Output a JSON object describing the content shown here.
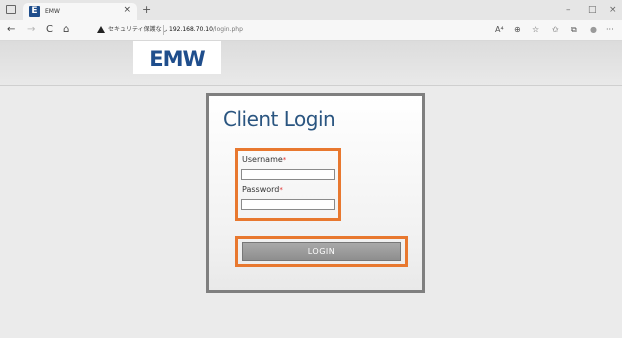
{
  "browser": {
    "tab": {
      "favicon": "E",
      "title": "EMW",
      "close": "×"
    },
    "new_tab": "+",
    "window": {
      "minimize": "–",
      "maximize": "□",
      "close": "×"
    },
    "nav": {
      "back": "←",
      "forward": "→",
      "reload": "C",
      "home": "⌂"
    },
    "security_text": "セキュリティ保護なし",
    "url_host": "192.168.70.10",
    "url_path": "/login.php",
    "toolbar_icons": {
      "read_aloud": "A⁴",
      "immersive": "⊕",
      "favorite_add": "☆",
      "favorites": "✩",
      "collections": "⧉",
      "profile": "●",
      "more": "···"
    }
  },
  "page": {
    "logo": "EMW",
    "login": {
      "title": "Client Login",
      "username_label": "Username",
      "password_label": "Password",
      "required_marker": "*",
      "username_value": "",
      "password_value": "",
      "button_label": "LOGIN"
    }
  },
  "colors": {
    "brand_blue": "#1f4e8c",
    "title_blue": "#2a5580",
    "highlight_orange": "#e8782f",
    "required_red": "#e03030"
  }
}
